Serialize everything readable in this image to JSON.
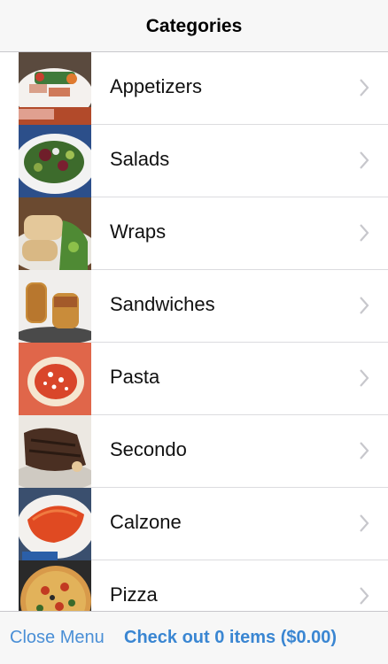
{
  "navbar": {
    "title": "Categories"
  },
  "categories": [
    {
      "label": "Appetizers"
    },
    {
      "label": "Salads"
    },
    {
      "label": "Wraps"
    },
    {
      "label": "Sandwiches"
    },
    {
      "label": "Pasta"
    },
    {
      "label": "Secondo"
    },
    {
      "label": "Calzone"
    },
    {
      "label": "Pizza"
    }
  ],
  "toolbar": {
    "close_label": "Close Menu",
    "checkout_label": "Check out 0 items ($0.00)"
  },
  "colors": {
    "accent": "#3a86d2",
    "chevron": "#c7c7cc"
  }
}
